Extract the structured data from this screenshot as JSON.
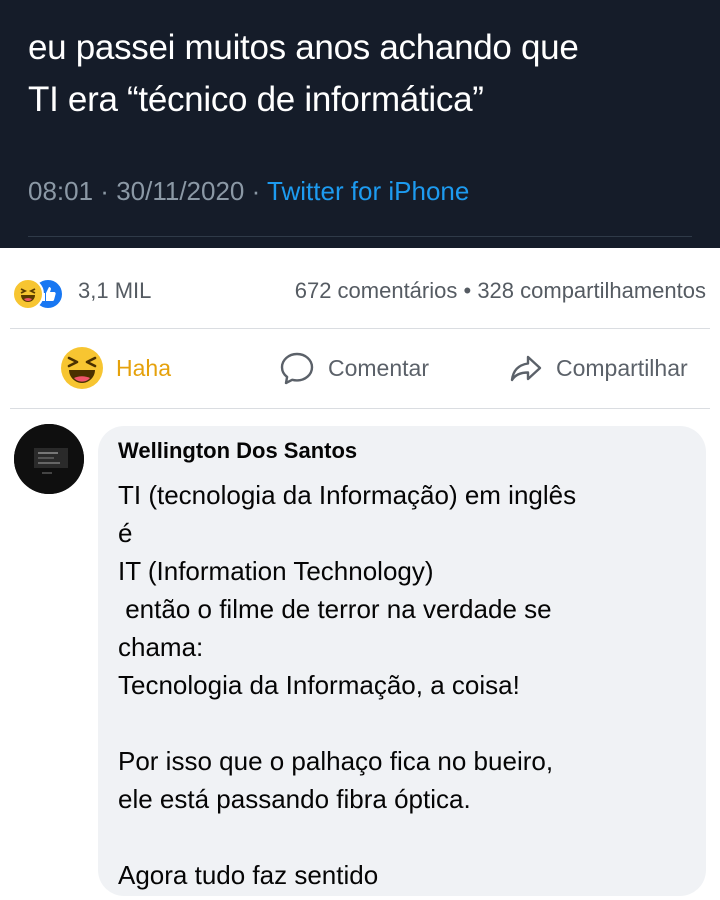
{
  "tweet": {
    "lines": [
      "eu passei muitos anos achando que",
      "TI era “técnico de informática”"
    ],
    "time": "08:01",
    "separator": " · ",
    "date": "30/11/2020",
    "source": "Twitter for iPhone"
  },
  "reactions": {
    "count": "3,1 MIL",
    "comments": "672 comentários",
    "dot": " • ",
    "shares": "328 compartilhamentos"
  },
  "actions": {
    "haha_label": "Haha",
    "comment_label": "Comentar",
    "share_label": "Compartilhar"
  },
  "comment": {
    "author": "Wellington Dos Santos",
    "lines": [
      "TI (tecnologia da Informação) em inglês",
      "é",
      "IT (Information Technology)",
      " então o filme de terror na verdade se",
      "chama:",
      "Tecnologia da Informação, a coisa!",
      "",
      "Por isso que o palhaço fica no bueiro,",
      "ele está passando fibra óptica.",
      "",
      "Agora tudo faz sentido"
    ]
  },
  "colors": {
    "tweet_bg": "#151c29",
    "link": "#1d9bf0",
    "haha": "#f7c531",
    "like": "#1877f2",
    "bubble": "#f0f2f5"
  },
  "icons": [
    "haha-emoji-icon",
    "like-icon",
    "comment-icon",
    "share-icon"
  ]
}
